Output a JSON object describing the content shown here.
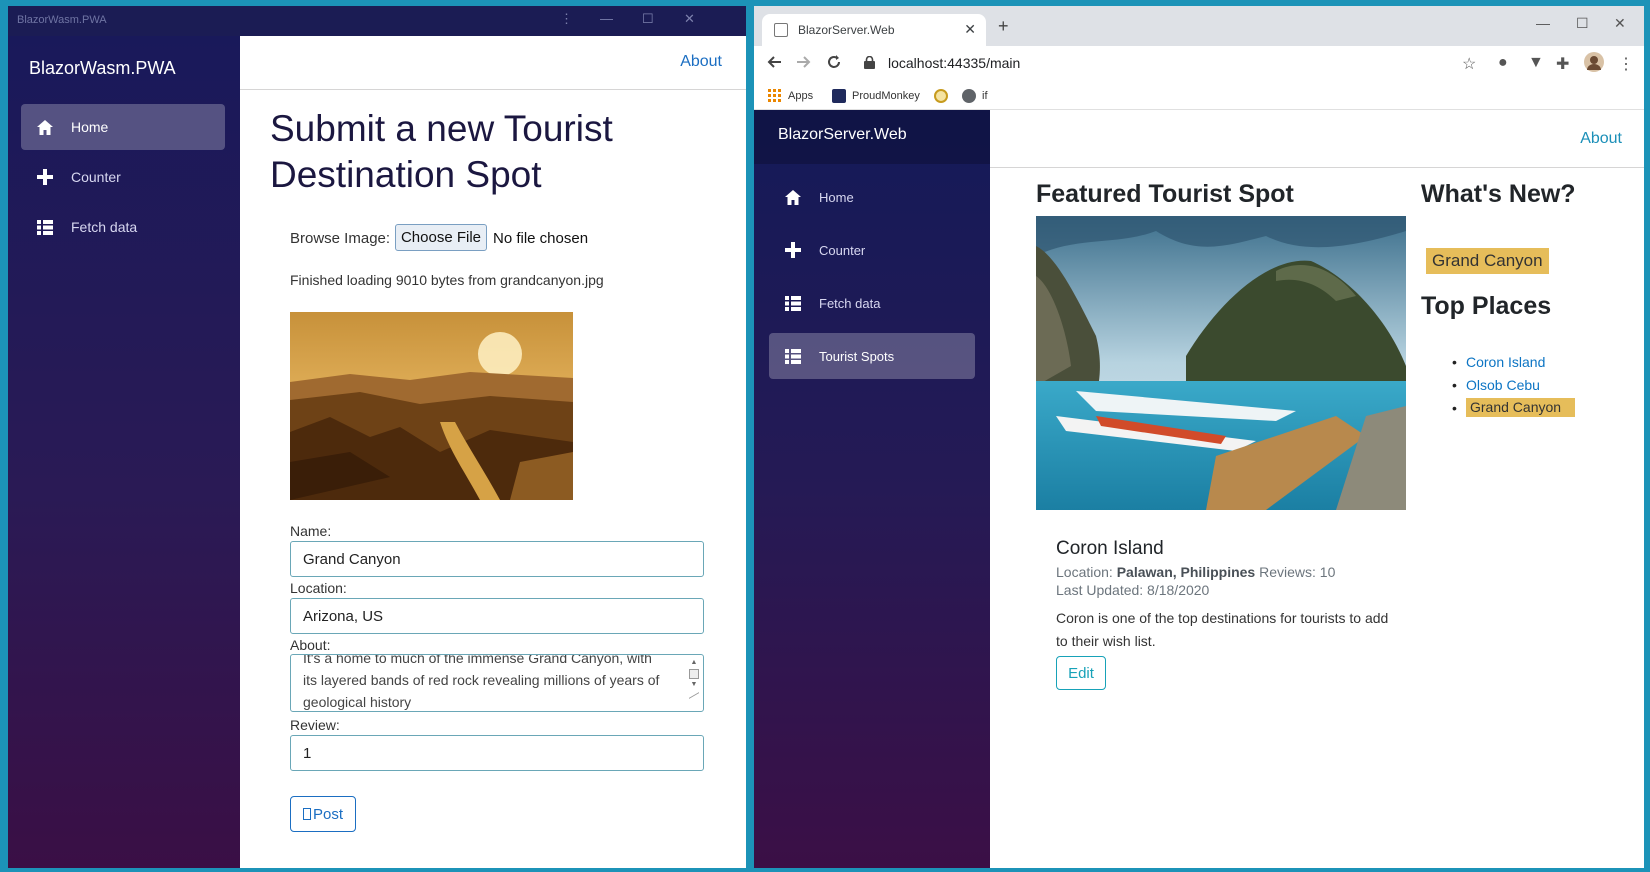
{
  "left_window": {
    "title": "BlazorWasm.PWA",
    "controls": {
      "menu": "⋮",
      "minimize": "—",
      "maximize": "☐",
      "close": "✕"
    },
    "brand": "BlazorWasm.PWA",
    "nav": [
      {
        "label": "Home",
        "icon": "home-icon",
        "active": true
      },
      {
        "label": "Counter",
        "icon": "plus-icon",
        "active": false
      },
      {
        "label": "Fetch data",
        "icon": "list-icon",
        "active": false
      }
    ],
    "about": "About",
    "page_title": "Submit a new Tourist Destination Spot",
    "browse_label": "Browse Image:",
    "choose_file": "Choose File",
    "no_file": "No file chosen",
    "loading_status": "Finished loading 9010 bytes from grandcanyon.jpg",
    "form": {
      "name_label": "Name:",
      "name_value": "Grand Canyon",
      "location_label": "Location:",
      "location_value": "Arizona, US",
      "about_label": "About:",
      "about_value": "It's a home to much of the immense Grand Canyon, with its layered bands of red rock revealing millions of years of geological history",
      "review_label": "Review:",
      "review_value": "1",
      "post_button": "Post"
    }
  },
  "right_window": {
    "tab_title": "BlazorServer.Web",
    "url": "localhost:44335/main",
    "bookmarks": [
      "Apps",
      "ProudMonkey",
      "if"
    ],
    "brand": "BlazorServer.Web",
    "nav": [
      {
        "label": "Home",
        "icon": "home-icon",
        "active": false
      },
      {
        "label": "Counter",
        "icon": "plus-icon",
        "active": false
      },
      {
        "label": "Fetch data",
        "icon": "list-icon",
        "active": false
      },
      {
        "label": "Tourist Spots",
        "icon": "list-icon",
        "active": true
      }
    ],
    "about": "About",
    "featured_heading": "Featured Tourist Spot",
    "featured": {
      "name": "Coron Island",
      "location_label": "Location:",
      "location_value": "Palawan, Philippines",
      "reviews": "Reviews: 10",
      "last_updated": "Last Updated: 8/18/2020",
      "description": "Coron is one of the top destinations for tourists to add to their wish list.",
      "edit_button": "Edit"
    },
    "whats_new_heading": "What's New?",
    "whats_new_item": "Grand Canyon",
    "top_places_heading": "Top Places",
    "top_places": [
      "Coron Island",
      "Olsob Cebu",
      "Grand Canyon"
    ]
  },
  "colors": {
    "sidebar_top": "#19195a",
    "sidebar_bottom": "#3a0f45",
    "link": "#1b6ec2",
    "highlight": "#e6bd5a",
    "desktop": "#1c93b8"
  }
}
